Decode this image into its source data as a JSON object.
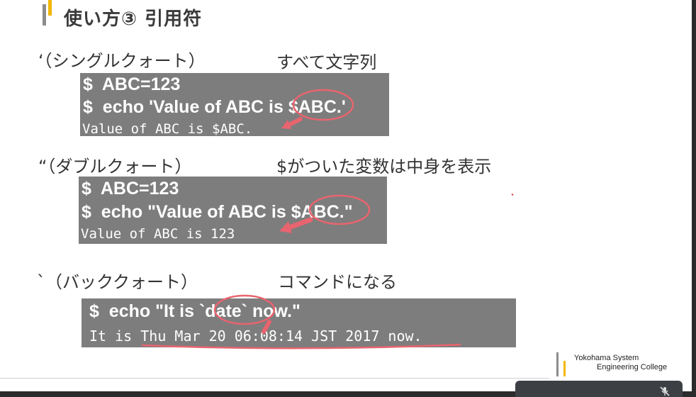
{
  "slide": {
    "title": "使い方③ 引用符",
    "sections": [
      {
        "label": "‘（シングルクォート）",
        "desc": "すべて文字列",
        "lines": [
          "$  ABC=123",
          "$  echo 'Value of ABC is $ABC.'",
          "Value of ABC is $ABC."
        ]
      },
      {
        "label": "“（ダブルクォート）",
        "desc": "$がついた変数は中身を表示",
        "lines": [
          "$  ABC=123",
          "$  echo \"Value of ABC is $ABC.\"",
          "Value of ABC is 123"
        ]
      },
      {
        "label": "`（バッククォート）",
        "desc": "コマンドになる",
        "lines": [
          "$  echo \"It is `date` now.\"",
          "It is Thu Mar 20 06:08:14 JST 2017 now."
        ]
      }
    ],
    "logo": {
      "line1": "Yokohama System",
      "line2": "Engineering College"
    },
    "annotation_color": "#e8646e"
  }
}
